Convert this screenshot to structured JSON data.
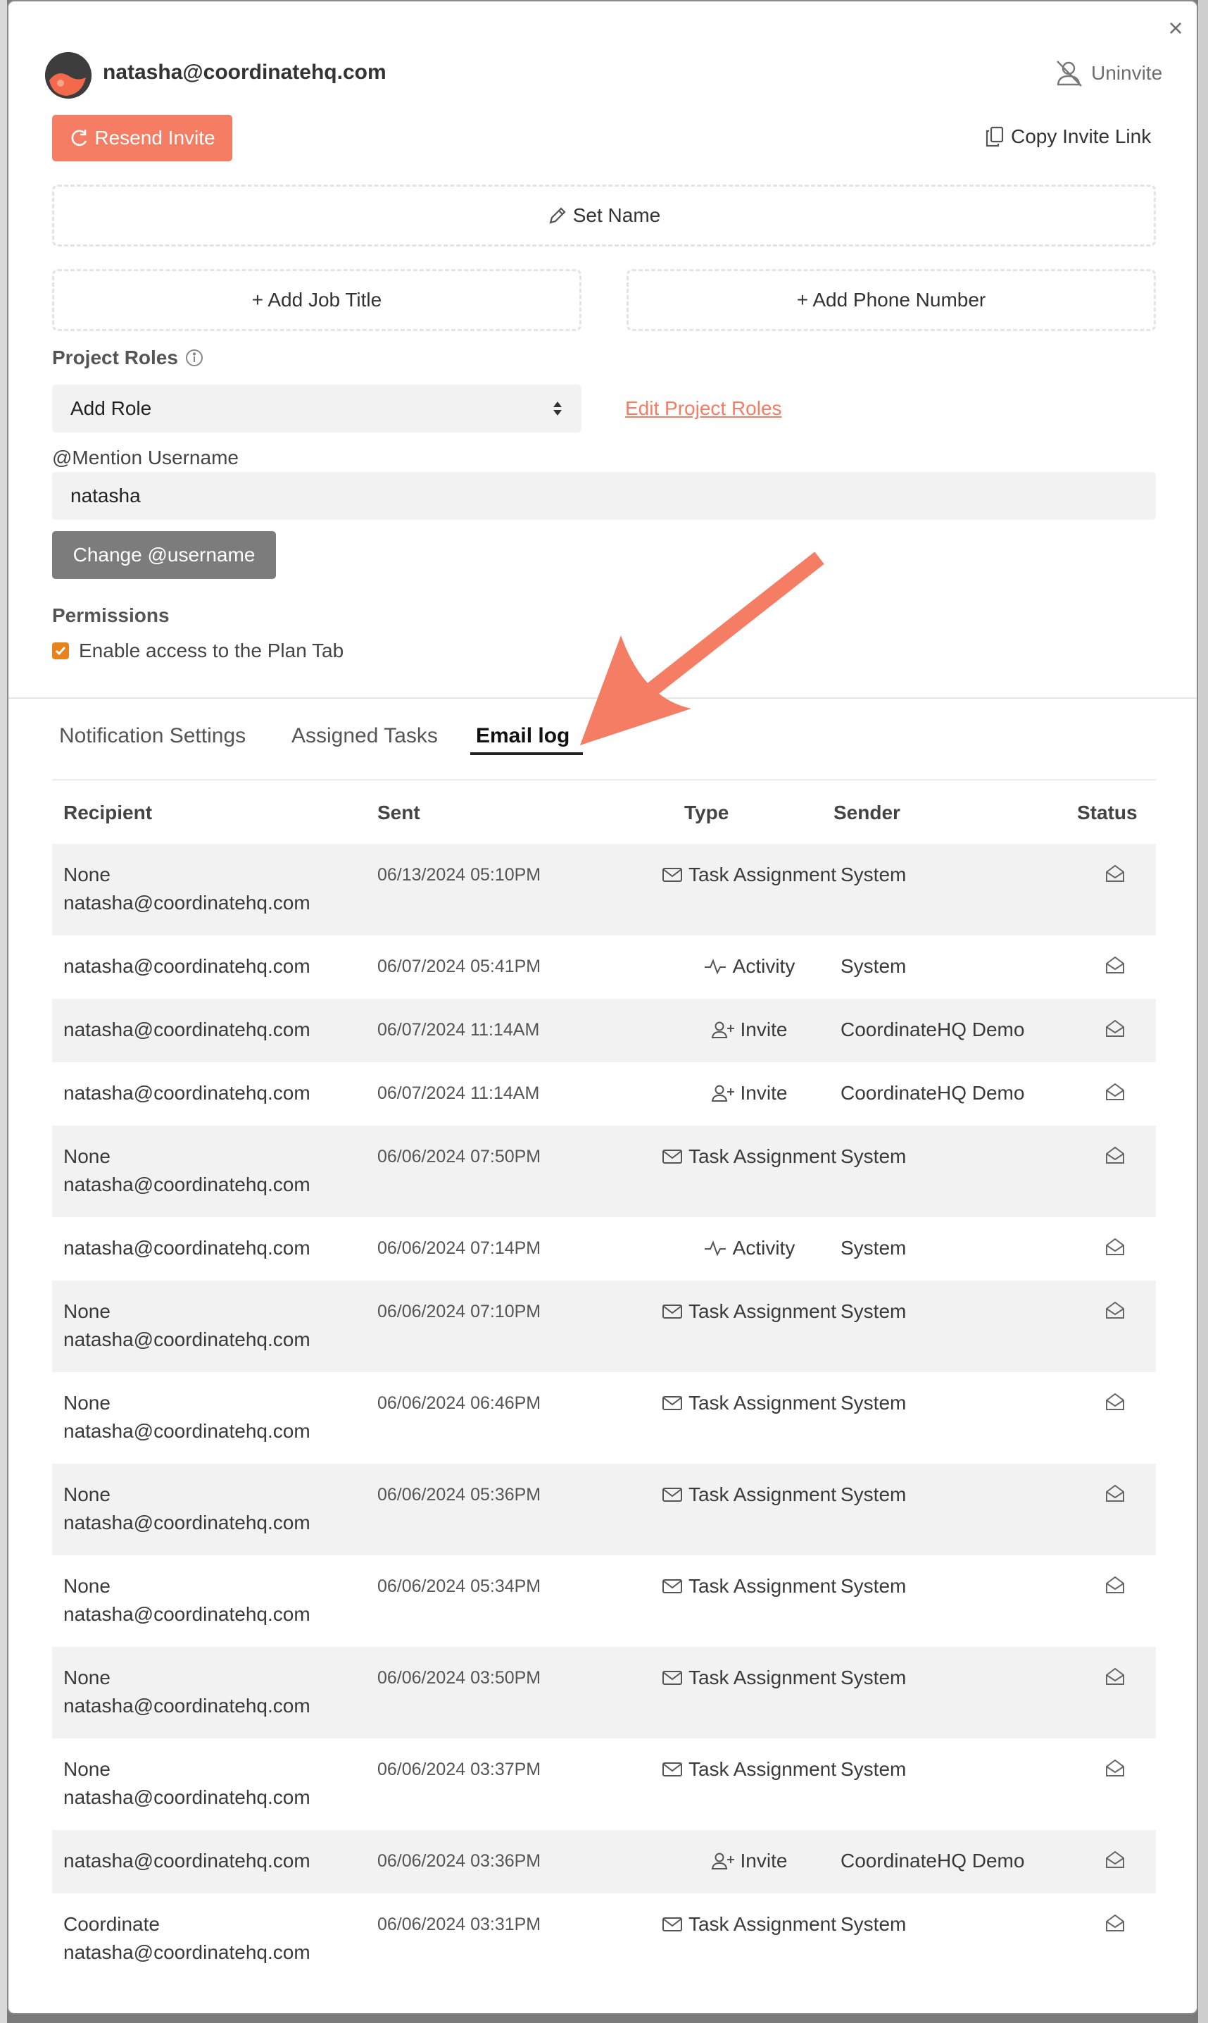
{
  "dialog": {
    "close_glyph": "×",
    "user_email": "natasha@coordinatehq.com",
    "uninvite_label": "Uninvite",
    "resend_label": "Resend Invite",
    "copy_link_label": "Copy Invite Link",
    "set_name_label": "Set Name",
    "add_job_title_label": "+ Add Job Title",
    "add_phone_label": "+ Add Phone Number",
    "project_roles_label": "Project Roles",
    "role_select_value": "Add Role",
    "edit_roles_label": "Edit Project Roles",
    "mention_label": "@Mention Username",
    "username_value": "natasha",
    "change_username_label": "Change @username",
    "permissions_label": "Permissions",
    "plan_tab_label": "Enable access to the Plan Tab",
    "plan_tab_checked": true,
    "accent_color": "#f47d63"
  },
  "tabs": [
    {
      "label": "Notification Settings",
      "active": false
    },
    {
      "label": "Assigned Tasks",
      "active": false
    },
    {
      "label": "Email log",
      "active": true
    }
  ],
  "table": {
    "headers": {
      "recipient": "Recipient",
      "sent": "Sent",
      "type": "Type",
      "sender": "Sender",
      "status": "Status"
    },
    "rows": [
      {
        "recipient_name": "None",
        "recipient_email": "natasha@coordinatehq.com",
        "sent": "06/13/2024 05:10PM",
        "type": "Task Assignment",
        "type_icon": "mail-icon",
        "sender": "System",
        "status_icon": "envelope-open-icon"
      },
      {
        "recipient_name": "",
        "recipient_email": "natasha@coordinatehq.com",
        "sent": "06/07/2024 05:41PM",
        "type": "Activity",
        "type_icon": "activity-icon",
        "sender": "System",
        "status_icon": "envelope-open-icon"
      },
      {
        "recipient_name": "",
        "recipient_email": "natasha@coordinatehq.com",
        "sent": "06/07/2024 11:14AM",
        "type": "Invite",
        "type_icon": "user-plus-icon",
        "sender": "CoordinateHQ Demo",
        "status_icon": "envelope-open-icon"
      },
      {
        "recipient_name": "",
        "recipient_email": "natasha@coordinatehq.com",
        "sent": "06/07/2024 11:14AM",
        "type": "Invite",
        "type_icon": "user-plus-icon",
        "sender": "CoordinateHQ Demo",
        "status_icon": "envelope-open-icon"
      },
      {
        "recipient_name": "None",
        "recipient_email": "natasha@coordinatehq.com",
        "sent": "06/06/2024 07:50PM",
        "type": "Task Assignment",
        "type_icon": "mail-icon",
        "sender": "System",
        "status_icon": "envelope-open-icon"
      },
      {
        "recipient_name": "",
        "recipient_email": "natasha@coordinatehq.com",
        "sent": "06/06/2024 07:14PM",
        "type": "Activity",
        "type_icon": "activity-icon",
        "sender": "System",
        "status_icon": "envelope-open-icon"
      },
      {
        "recipient_name": "None",
        "recipient_email": "natasha@coordinatehq.com",
        "sent": "06/06/2024 07:10PM",
        "type": "Task Assignment",
        "type_icon": "mail-icon",
        "sender": "System",
        "status_icon": "envelope-open-icon"
      },
      {
        "recipient_name": "None",
        "recipient_email": "natasha@coordinatehq.com",
        "sent": "06/06/2024 06:46PM",
        "type": "Task Assignment",
        "type_icon": "mail-icon",
        "sender": "System",
        "status_icon": "envelope-open-icon"
      },
      {
        "recipient_name": "None",
        "recipient_email": "natasha@coordinatehq.com",
        "sent": "06/06/2024 05:36PM",
        "type": "Task Assignment",
        "type_icon": "mail-icon",
        "sender": "System",
        "status_icon": "envelope-open-icon"
      },
      {
        "recipient_name": "None",
        "recipient_email": "natasha@coordinatehq.com",
        "sent": "06/06/2024 05:34PM",
        "type": "Task Assignment",
        "type_icon": "mail-icon",
        "sender": "System",
        "status_icon": "envelope-open-icon"
      },
      {
        "recipient_name": "None",
        "recipient_email": "natasha@coordinatehq.com",
        "sent": "06/06/2024 03:50PM",
        "type": "Task Assignment",
        "type_icon": "mail-icon",
        "sender": "System",
        "status_icon": "envelope-open-icon"
      },
      {
        "recipient_name": "None",
        "recipient_email": "natasha@coordinatehq.com",
        "sent": "06/06/2024 03:37PM",
        "type": "Task Assignment",
        "type_icon": "mail-icon",
        "sender": "System",
        "status_icon": "envelope-open-icon"
      },
      {
        "recipient_name": "",
        "recipient_email": "natasha@coordinatehq.com",
        "sent": "06/06/2024 03:36PM",
        "type": "Invite",
        "type_icon": "user-plus-icon",
        "sender": "CoordinateHQ Demo",
        "status_icon": "envelope-open-icon"
      },
      {
        "recipient_name": "Coordinate",
        "recipient_email": "natasha@coordinatehq.com",
        "sent": "06/06/2024 03:31PM",
        "type": "Task Assignment",
        "type_icon": "mail-icon",
        "sender": "System",
        "status_icon": "envelope-open-icon"
      }
    ]
  },
  "annotation": {
    "arrow_color": "#f47d63"
  }
}
